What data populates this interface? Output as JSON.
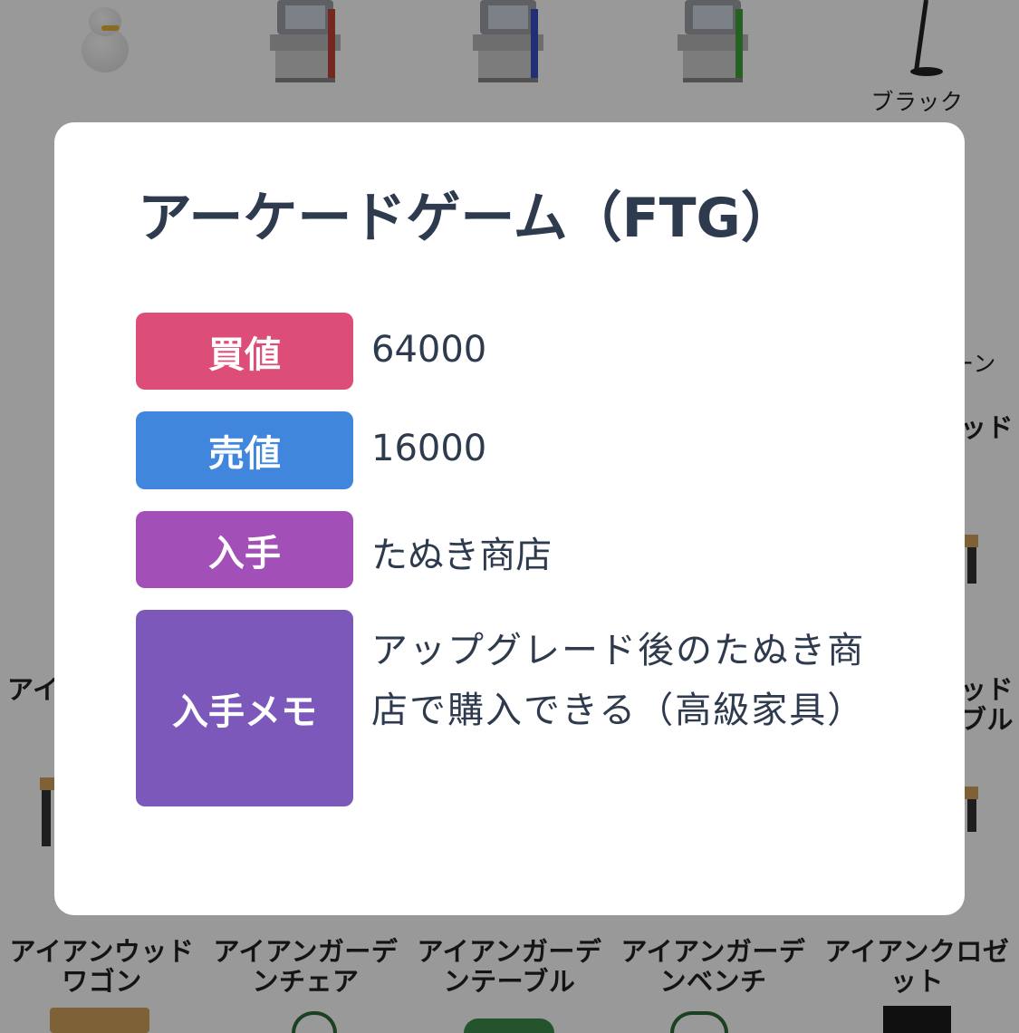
{
  "background": {
    "top_labels": [
      "ブラック"
    ],
    "partial_labels": [
      "ーン",
      "ッド",
      "アイ",
      "ッド",
      "ブル"
    ],
    "bottom_labels": [
      {
        "line1": "アイアンウッド",
        "line2": "ワゴン"
      },
      {
        "line1": "アイアンガーデ",
        "line2": "ンチェア"
      },
      {
        "line1": "アイアンガーデ",
        "line2": "ンテーブル"
      },
      {
        "line1": "アイアンガーデ",
        "line2": "ンベンチ"
      },
      {
        "line1": "アイアンクロゼ",
        "line2": "ット"
      }
    ],
    "icons": [
      "snowman-icon",
      "arcade-red-icon",
      "arcade-blue-icon",
      "arcade-green-icon",
      "floor-lamp-icon",
      "table-icon"
    ]
  },
  "modal": {
    "title": "アーケードゲーム（FTG）",
    "rows": [
      {
        "label": "買値",
        "value": "64000",
        "color": "#dc4d78"
      },
      {
        "label": "売値",
        "value": "16000",
        "color": "#3f86dc"
      },
      {
        "label": "入手",
        "value": "たぬき商店",
        "color": "#a24fb7"
      },
      {
        "label": "入手メモ",
        "value": "アップグレード後のたぬき商店で購入できる（高級家具）",
        "color": "#7b58b9"
      }
    ]
  }
}
